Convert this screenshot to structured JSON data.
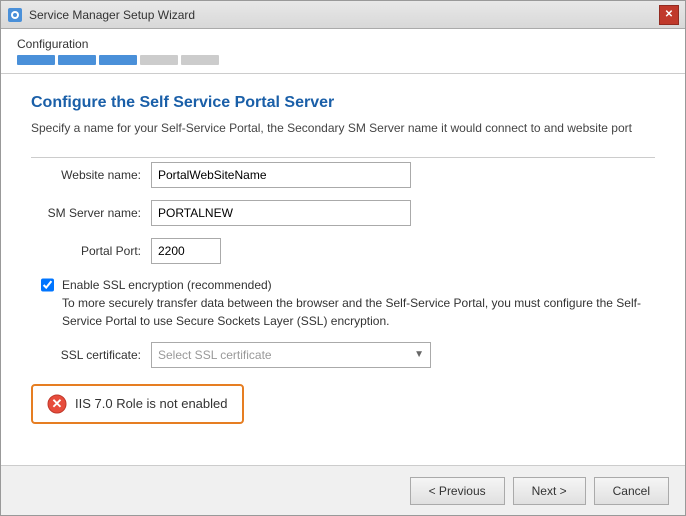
{
  "window": {
    "title": "Service Manager Setup Wizard",
    "icon": "gear-icon"
  },
  "progress": {
    "label": "Configuration",
    "steps": [
      {
        "id": 1,
        "state": "filled"
      },
      {
        "id": 2,
        "state": "filled"
      },
      {
        "id": 3,
        "state": "active"
      },
      {
        "id": 4,
        "state": "empty"
      },
      {
        "id": 5,
        "state": "empty"
      }
    ]
  },
  "section": {
    "title": "Configure the Self Service Portal Server",
    "description": "Specify a name for your Self-Service Portal, the Secondary SM Server name it would connect to and website port"
  },
  "form": {
    "website_label": "Website name:",
    "website_value": "PortalWebSiteName",
    "sm_server_label": "SM Server name:",
    "sm_server_value": "PORTALNEW",
    "portal_port_label": "Portal Port:",
    "portal_port_value": "2200",
    "ssl_checkbox_label": "Enable SSL encryption (recommended)",
    "ssl_checkbox_desc": "To more securely transfer data between the browser and the Self-Service Portal, you must configure the Self-Service Portal to use Secure Sockets Layer (SSL) encryption.",
    "ssl_cert_label": "SSL certificate:",
    "ssl_cert_placeholder": "Select SSL certificate"
  },
  "error": {
    "text": "IIS 7.0 Role is not enabled"
  },
  "buttons": {
    "previous": "< Previous",
    "next": "Next >",
    "cancel": "Cancel"
  }
}
